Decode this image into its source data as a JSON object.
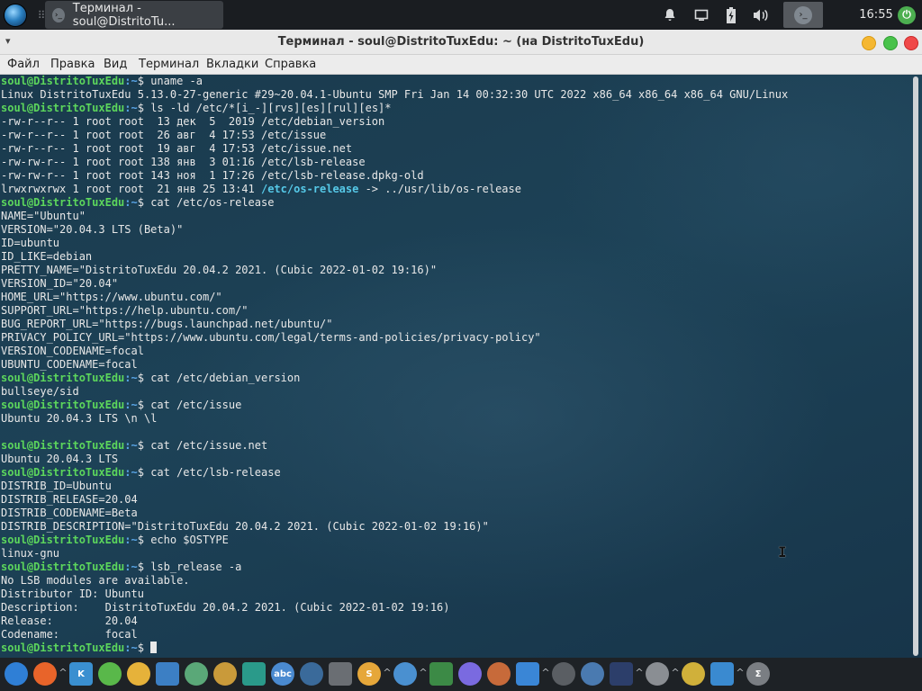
{
  "top_panel": {
    "task_title": "Терминал - soul@DistritoTu...",
    "clock": "16:55",
    "handle_glyph": "⠿",
    "icons": [
      "distro-logo-icon",
      "terminal-icon",
      "bell-icon",
      "display-icon",
      "battery-icon",
      "volume-icon",
      "tray-terminal-icon",
      "power-icon"
    ]
  },
  "window": {
    "title": "Терминал - soul@DistritoTuxEdu: ~ (на DistritoTuxEdu)",
    "menu": [
      "Файл",
      "Правка",
      "Вид",
      "Терминал",
      "Вкладки",
      "Справка"
    ]
  },
  "terminal": {
    "prompt_user": "soul@DistritoTuxEdu",
    "prompt_path": ":~",
    "prompt_symbol": "$ ",
    "lines": [
      {
        "t": "prompt",
        "cmd": "uname -a"
      },
      {
        "t": "out",
        "text": "Linux DistritoTuxEdu 5.13.0-27-generic #29~20.04.1-Ubuntu SMP Fri Jan 14 00:32:30 UTC 2022 x86_64 x86_64 x86_64 GNU/Linux"
      },
      {
        "t": "prompt",
        "cmd": "ls -ld /etc/*[i_-][rvs][es][rul][es]*"
      },
      {
        "t": "out",
        "text": "-rw-r--r-- 1 root root  13 дек  5  2019 /etc/debian_version"
      },
      {
        "t": "out",
        "text": "-rw-r--r-- 1 root root  26 авг  4 17:53 /etc/issue"
      },
      {
        "t": "out",
        "text": "-rw-r--r-- 1 root root  19 авг  4 17:53 /etc/issue.net"
      },
      {
        "t": "out",
        "text": "-rw-rw-r-- 1 root root 138 янв  3 01:16 /etc/lsb-release"
      },
      {
        "t": "out",
        "text": "-rw-rw-r-- 1 root root 143 ноя  1 17:26 /etc/lsb-release.dpkg-old"
      },
      {
        "t": "link",
        "pre": "lrwxrwxrwx 1 root root  21 янв 25 13:41 ",
        "hl": "/etc/os-release",
        "post": " -> ../usr/lib/os-release"
      },
      {
        "t": "prompt",
        "cmd": "cat /etc/os-release"
      },
      {
        "t": "out",
        "text": "NAME=\"Ubuntu\""
      },
      {
        "t": "out",
        "text": "VERSION=\"20.04.3 LTS (Beta)\""
      },
      {
        "t": "out",
        "text": "ID=ubuntu"
      },
      {
        "t": "out",
        "text": "ID_LIKE=debian"
      },
      {
        "t": "out",
        "text": "PRETTY_NAME=\"DistritoTuxEdu 20.04.2 2021. (Cubic 2022-01-02 19:16)\""
      },
      {
        "t": "out",
        "text": "VERSION_ID=\"20.04\""
      },
      {
        "t": "out",
        "text": "HOME_URL=\"https://www.ubuntu.com/\""
      },
      {
        "t": "out",
        "text": "SUPPORT_URL=\"https://help.ubuntu.com/\""
      },
      {
        "t": "out",
        "text": "BUG_REPORT_URL=\"https://bugs.launchpad.net/ubuntu/\""
      },
      {
        "t": "out",
        "text": "PRIVACY_POLICY_URL=\"https://www.ubuntu.com/legal/terms-and-policies/privacy-policy\""
      },
      {
        "t": "out",
        "text": "VERSION_CODENAME=focal"
      },
      {
        "t": "out",
        "text": "UBUNTU_CODENAME=focal"
      },
      {
        "t": "prompt",
        "cmd": "cat /etc/debian_version"
      },
      {
        "t": "out",
        "text": "bullseye/sid"
      },
      {
        "t": "prompt",
        "cmd": "cat /etc/issue"
      },
      {
        "t": "out",
        "text": "Ubuntu 20.04.3 LTS \\n \\l"
      },
      {
        "t": "out",
        "text": ""
      },
      {
        "t": "prompt",
        "cmd": "cat /etc/issue.net"
      },
      {
        "t": "out",
        "text": "Ubuntu 20.04.3 LTS"
      },
      {
        "t": "prompt",
        "cmd": "cat /etc/lsb-release"
      },
      {
        "t": "out",
        "text": "DISTRIB_ID=Ubuntu"
      },
      {
        "t": "out",
        "text": "DISTRIB_RELEASE=20.04"
      },
      {
        "t": "out",
        "text": "DISTRIB_CODENAME=Beta"
      },
      {
        "t": "out",
        "text": "DISTRIB_DESCRIPTION=\"DistritoTuxEdu 20.04.2 2021. (Cubic 2022-01-02 19:16)\""
      },
      {
        "t": "prompt",
        "cmd": "echo $OSTYPE"
      },
      {
        "t": "out",
        "text": "linux-gnu"
      },
      {
        "t": "prompt",
        "cmd": "lsb_release -a"
      },
      {
        "t": "out",
        "text": "No LSB modules are available."
      },
      {
        "t": "out",
        "text": "Distributor ID:\tUbuntu"
      },
      {
        "t": "out",
        "text": "Description:\tDistritoTuxEdu 20.04.2 2021. (Cubic 2022-01-02 19:16)"
      },
      {
        "t": "out",
        "text": "Release:\t20.04"
      },
      {
        "t": "out",
        "text": "Codename:\tfocal"
      },
      {
        "t": "cursor",
        "cmd": ""
      }
    ]
  },
  "dock": {
    "items": [
      {
        "name": "dock-files-icon",
        "bg": "#2f7fd6",
        "glyph": "",
        "caret": false
      },
      {
        "name": "dock-firefox-icon",
        "bg": "#e8642a",
        "glyph": "",
        "caret": true
      },
      {
        "name": "dock-kde-connect-icon",
        "bg": "#3a8fd0",
        "glyph": "K",
        "caret": false
      },
      {
        "name": "dock-gcompris-icon",
        "bg": "#59b84a",
        "glyph": "",
        "caret": false
      },
      {
        "name": "dock-hand-app-icon",
        "bg": "#e6b23a",
        "glyph": "",
        "caret": false
      },
      {
        "name": "dock-distrito-icon",
        "bg": "#3c7fc4",
        "glyph": "",
        "caret": false
      },
      {
        "name": "dock-chat-icon",
        "bg": "#5aa878",
        "glyph": "",
        "caret": false
      },
      {
        "name": "dock-tux-math-icon",
        "bg": "#c99a3a",
        "glyph": "",
        "caret": false
      },
      {
        "name": "dock-tux-paint-icon",
        "bg": "#2a9a8a",
        "glyph": "",
        "caret": false
      },
      {
        "name": "dock-abc-icon",
        "bg": "#4a8ad0",
        "glyph": "abc",
        "caret": false
      },
      {
        "name": "dock-learning-icon",
        "bg": "#3a6a9a",
        "glyph": "",
        "caret": false
      },
      {
        "name": "dock-clock-app-icon",
        "bg": "#6a6e73",
        "glyph": "",
        "caret": false
      },
      {
        "name": "dock-scratch-icon",
        "bg": "#e6a73a",
        "glyph": "S",
        "caret": true
      },
      {
        "name": "dock-atlas-icon",
        "bg": "#4a90d0",
        "glyph": "",
        "caret": true
      },
      {
        "name": "dock-board-icon",
        "bg": "#3c8a46",
        "glyph": "",
        "caret": false
      },
      {
        "name": "dock-bubbles-icon",
        "bg": "#7a6ae0",
        "glyph": "",
        "caret": false
      },
      {
        "name": "dock-pomodoro-icon",
        "bg": "#c76a3a",
        "glyph": "",
        "caret": false
      },
      {
        "name": "dock-marble-icon",
        "bg": "#3a86d6",
        "glyph": "",
        "caret": true
      },
      {
        "name": "dock-chat-bubbles-icon",
        "bg": "#5a5e63",
        "glyph": "",
        "caret": false
      },
      {
        "name": "dock-ellipse-icon",
        "bg": "#4a7ab0",
        "glyph": "",
        "caret": false
      },
      {
        "name": "dock-stellarium-icon",
        "bg": "#2c3e6a",
        "glyph": "",
        "caret": true
      },
      {
        "name": "dock-fraction-icon",
        "bg": "#8a8e93",
        "glyph": "",
        "caret": true
      },
      {
        "name": "dock-geogebra-icon",
        "bg": "#d0b03a",
        "glyph": "",
        "caret": false
      },
      {
        "name": "dock-molecule-icon",
        "bg": "#3a8ad0",
        "glyph": "",
        "caret": true
      },
      {
        "name": "dock-sum-icon",
        "bg": "#7a7e83",
        "glyph": "Σ",
        "caret": false
      }
    ]
  }
}
